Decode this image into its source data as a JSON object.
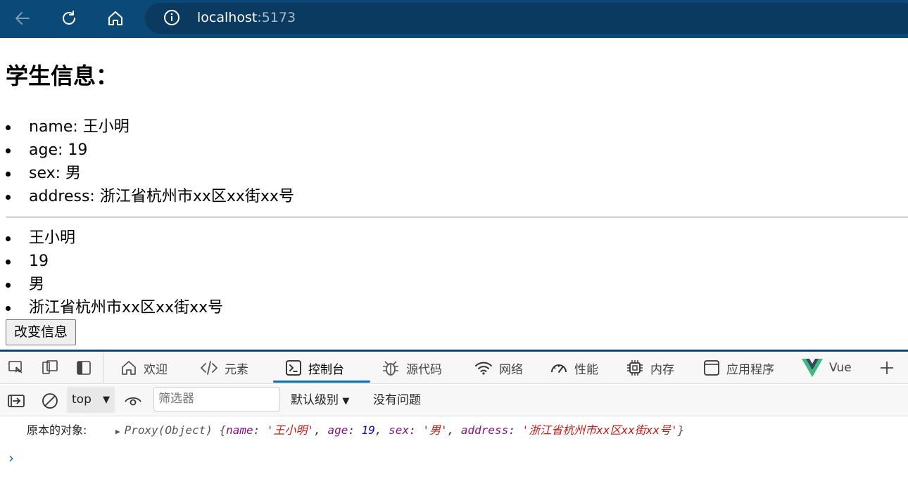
{
  "browser": {
    "url_host": "localhost",
    "url_port": ":5173",
    "icons": [
      "back-arrow-icon",
      "refresh-icon",
      "home-icon",
      "info-icon"
    ]
  },
  "page": {
    "title": "学生信息：",
    "details": [
      "name: 王小明",
      "age: 19",
      "sex: 男",
      "address: 浙江省杭州市xx区xx街xx号"
    ],
    "values": [
      "王小明",
      "19",
      "男",
      "浙江省杭州市xx区xx街xx号"
    ],
    "button_label": "改变信息"
  },
  "devtools": {
    "tabs": [
      {
        "label": "欢迎",
        "icon": "home-icon"
      },
      {
        "label": "元素",
        "icon": "code-icon"
      },
      {
        "label": "控制台",
        "icon": "console-icon",
        "active": true
      },
      {
        "label": "源代码",
        "icon": "bug-icon"
      },
      {
        "label": "网络",
        "icon": "wifi-icon"
      },
      {
        "label": "性能",
        "icon": "gauge-icon"
      },
      {
        "label": "内存",
        "icon": "chip-icon"
      },
      {
        "label": "应用程序",
        "icon": "app-icon"
      },
      {
        "label": "Vue",
        "icon": "vue-logo-icon"
      }
    ],
    "toolbar": {
      "context": "top",
      "filter_placeholder": "筛选器",
      "levels": "默认级别",
      "issues": "没有问题"
    },
    "console": {
      "label": "原本的对象:",
      "object_prefix": "Proxy(Object) {",
      "entries": [
        {
          "key": "name",
          "value": "'王小明'",
          "kind": "str"
        },
        {
          "key": "age",
          "value": "19",
          "kind": "num"
        },
        {
          "key": "sex",
          "value": "'男'",
          "kind": "str"
        },
        {
          "key": "address",
          "value": "'浙江省杭州市xx区xx街xx号'",
          "kind": "str"
        }
      ],
      "object_suffix": "}"
    }
  },
  "colors": {
    "browser_bar": "#0b4a78",
    "url_bar": "#0a3a5f",
    "accent": "#0f6cbd"
  }
}
